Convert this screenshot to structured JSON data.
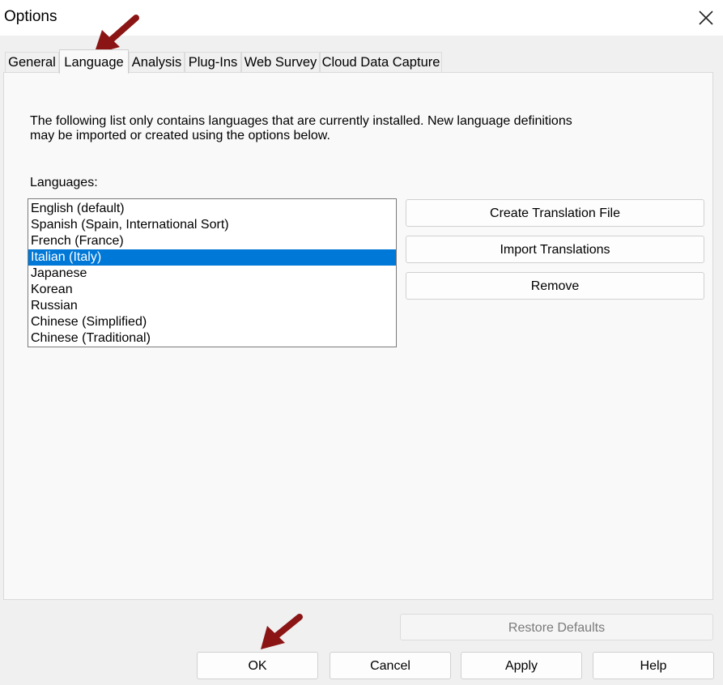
{
  "window": {
    "title": "Options"
  },
  "tabs": [
    {
      "label": "General",
      "active": false
    },
    {
      "label": "Language",
      "active": true
    },
    {
      "label": "Analysis",
      "active": false
    },
    {
      "label": "Plug-Ins",
      "active": false
    },
    {
      "label": "Web Survey",
      "active": false
    },
    {
      "label": "Cloud Data Capture",
      "active": false
    }
  ],
  "language_panel": {
    "description_line1": "The following list only contains languages that are currently installed. New language definitions",
    "description_line2": "may be imported or created using the options below.",
    "languages_label": "Languages:",
    "languages": [
      "English (default)",
      "Spanish (Spain, International Sort)",
      "French (France)",
      "Italian (Italy)",
      "Japanese",
      "Korean",
      "Russian",
      "Chinese (Simplified)",
      "Chinese (Traditional)"
    ],
    "selected_language": "Italian (Italy)",
    "buttons": {
      "create_translation": "Create Translation File",
      "import_translations": "Import Translations",
      "remove": "Remove"
    }
  },
  "footer": {
    "restore_defaults": "Restore Defaults",
    "ok": "OK",
    "cancel": "Cancel",
    "apply": "Apply",
    "help": "Help"
  },
  "colors": {
    "selection": "#0078d7",
    "annotation_arrow": "#8b1414"
  },
  "icons": {
    "close": "close-icon",
    "arrow": "annotation-arrow-icon"
  }
}
